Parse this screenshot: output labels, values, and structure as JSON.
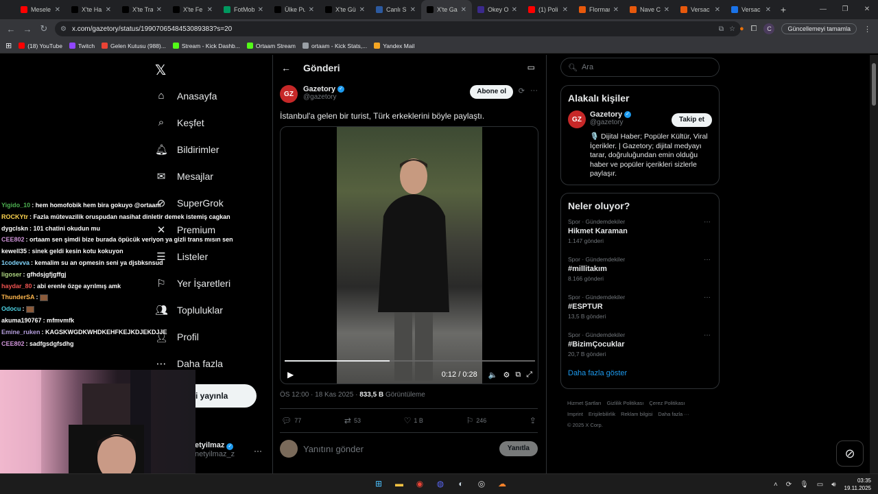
{
  "browser": {
    "tabs": [
      {
        "label": "Mesele",
        "icon": "youtube-icon",
        "color": "#ff0000"
      },
      {
        "label": "X'te Ha",
        "icon": "x-icon",
        "color": "#000000"
      },
      {
        "label": "X'te Tra",
        "icon": "x-icon",
        "color": "#000000"
      },
      {
        "label": "X'te Fe",
        "icon": "x-icon",
        "color": "#000000"
      },
      {
        "label": "FotMob",
        "icon": "fotmob-icon",
        "color": "#00985f"
      },
      {
        "label": "Ülke Pu",
        "icon": "x-icon",
        "color": "#000000"
      },
      {
        "label": "X'te Gü",
        "icon": "x-icon",
        "color": "#000000"
      },
      {
        "label": "Canlı Sk",
        "icon": "mackolik-icon",
        "color": "#2c5aa0"
      },
      {
        "label": "X'te Ga",
        "icon": "x-icon",
        "color": "#000000"
      },
      {
        "label": "Okey O",
        "icon": "okey-icon",
        "color": "#3b2a8c"
      },
      {
        "label": "(1) Poli",
        "icon": "youtube-icon",
        "color": "#ff0000"
      },
      {
        "label": "Florman",
        "icon": "site-icon",
        "color": "#e8590c"
      },
      {
        "label": "Nave C",
        "icon": "site-icon",
        "color": "#e8590c"
      },
      {
        "label": "Versac",
        "icon": "site-icon",
        "color": "#e8590c"
      },
      {
        "label": "Versac",
        "icon": "site-icon",
        "color": "#1a73e8"
      }
    ],
    "active_tab_index": 8,
    "url": "x.com/gazetory/status/1990706548453089383?s=20",
    "update_button": "Güncellemeyi tamamla",
    "profile_initial": "C",
    "bookmarks": [
      {
        "label": "(18) YouTube",
        "color": "#ff0000"
      },
      {
        "label": "Twitch",
        "color": "#9146ff"
      },
      {
        "label": "Gelen Kutusu (988)...",
        "color": "#ea4335"
      },
      {
        "label": "Stream - Kick Dashb...",
        "color": "#53fc18"
      },
      {
        "label": "Ortaam Stream",
        "color": "#53fc18"
      },
      {
        "label": "ortaam - Kick Stats,...",
        "color": "#9aa0a6"
      },
      {
        "label": "Yandex Mail",
        "color": "#f5a623"
      }
    ]
  },
  "sidebar": {
    "items": [
      {
        "label": "Anasayfa",
        "icon": "home-icon"
      },
      {
        "label": "Keşfet",
        "icon": "search-icon"
      },
      {
        "label": "Bildirimler",
        "icon": "bell-icon"
      },
      {
        "label": "Mesajlar",
        "icon": "envelope-icon"
      },
      {
        "label": "SuperGrok",
        "icon": "grok-icon"
      },
      {
        "label": "Premium",
        "icon": "x-icon"
      },
      {
        "label": "Listeler",
        "icon": "list-icon"
      },
      {
        "label": "Yer İşaretleri",
        "icon": "bookmark-icon"
      },
      {
        "label": "Topluluklar",
        "icon": "people-icon"
      },
      {
        "label": "Profil",
        "icon": "person-icon"
      },
      {
        "label": "Daha fazla",
        "icon": "more-circle-icon"
      }
    ],
    "post_button_partial": "eri yayınla",
    "account_name_partial": "etyilmaz",
    "account_handle_partial": "netyilmaz_z"
  },
  "post": {
    "header_title": "Gönderi",
    "author_name": "Gazetory",
    "author_handle": "@gazetory",
    "avatar_text": "GZ",
    "subscribe_label": "Abone ol",
    "text": "İstanbul'a gelen bir turist, Türk erkeklerini böyle paylaştı.",
    "video_time": "0:12 / 0:28",
    "video_progress": 0.42,
    "timestamp": "ÖS 12:00 · 18 Kas 2025 ·",
    "views": "833,5 B",
    "views_label": "Görüntüleme",
    "replies": "77",
    "reposts": "53",
    "likes": "1 B",
    "bookmarks": "246",
    "reply_placeholder": "Yanıtını gönder",
    "reply_button": "Yanıtla"
  },
  "right": {
    "search_placeholder": "Ara",
    "related_title": "Alakalı kişiler",
    "related": {
      "name": "Gazetory",
      "handle": "@gazetory",
      "follow_label": "Takip et",
      "bio": "🎙️ Dijital Haber; Popüler Kültür, Viral İçerikler. | Gazetory; dijital medyayı tarar, doğruluğundan emin olduğu haber ve popüler içerikleri sizlerle paylaşır."
    },
    "trends_title": "Neler oluyor?",
    "trends": [
      {
        "category": "Spor · Gündemdekiler",
        "name": "Hikmet Karaman",
        "posts": "1.147 gönderi"
      },
      {
        "category": "Spor · Gündemdekiler",
        "name": "#millitakım",
        "posts": "8.166 gönderi"
      },
      {
        "category": "Spor · Gündemdekiler",
        "name": "#ESPTUR",
        "posts": "13,5 B gönderi"
      },
      {
        "category": "Spor · Gündemdekiler",
        "name": "#BizimÇocuklar",
        "posts": "20,7 B gönderi"
      }
    ],
    "show_more": "Daha fazla göster",
    "footer_links": [
      "Hizmet Şartları",
      "Gizlilik Politikası",
      "Çerez Politikası",
      "Imprint",
      "Erişilebilirlik",
      "Reklam bilgisi",
      "Daha fazla ···"
    ],
    "copyright": "© 2025 X Corp."
  },
  "chat": [
    {
      "user": "Yigido_10",
      "color": "#4caf50",
      "message": ": hem homofobik hem bira gokuyo @ortaam"
    },
    {
      "user": "ROCKYtr",
      "color": "#ffd54f",
      "message": ": Fazla mütevazilik oruspudan nasihat dinletir demek istemiş cagkan"
    },
    {
      "user": "dygclskn",
      "color": "#ffffff",
      "message": ": 101 chatini okudun mu"
    },
    {
      "user": "CEE802",
      "color": "#ce93d8",
      "message": ": ortaam sen şimdi bize burada öpücük veriyon ya gizli trans mısın sen"
    },
    {
      "user": "kewell35",
      "color": "#ffffff",
      "message": ": sinek geldi kesin kotu kokuyon"
    },
    {
      "user": "1codevva",
      "color": "#81d4fa",
      "message": ": kemalim su an opmesin seni ya djsbksnsud"
    },
    {
      "user": "ligoser",
      "color": "#aed581",
      "message": ": gfhdsjgfjgffgj"
    },
    {
      "user": "haydar_80",
      "color": "#ef5350",
      "message": ": abi erenle özge ayrılmış amk"
    },
    {
      "user": "ThunderSA",
      "color": "#ffb74d",
      "message": ":"
    },
    {
      "user": "Odocu",
      "color": "#4dd0e1",
      "message": ":"
    },
    {
      "user": "akuma190767",
      "color": "#ffffff",
      "message": ": mfmvmfk"
    },
    {
      "user": "Emine_ruken",
      "color": "#b39ddb",
      "message": ": KAGSKWGDKWHDKEHFKEJKDJEKDJJE"
    },
    {
      "user": "CEE802",
      "color": "#ce93d8",
      "message": ": sadfgsdgfsdhg"
    }
  ],
  "taskbar": {
    "time": "03:35",
    "date": "19.11.2025"
  }
}
